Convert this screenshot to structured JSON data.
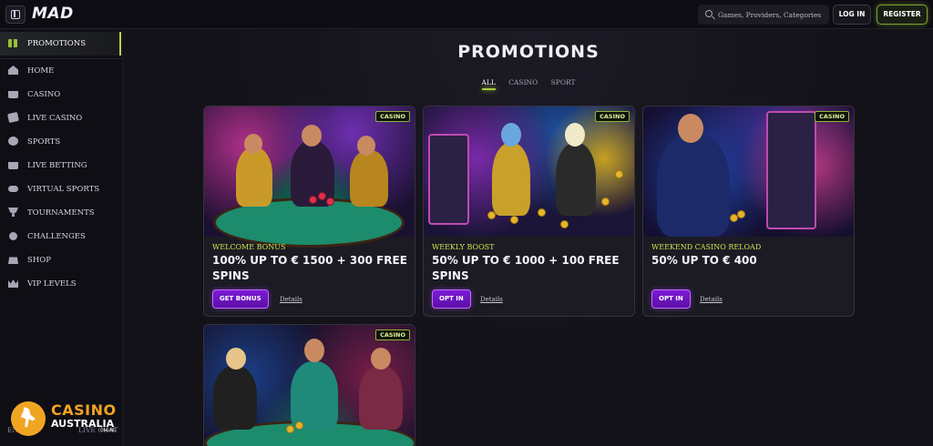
{
  "header": {
    "logo_text": "MAD",
    "search_placeholder": "Games, Providers, Categories",
    "login_label": "LOG IN",
    "register_label": "REGISTER"
  },
  "sidebar": {
    "promotions_label": "PROMOTIONS",
    "items": [
      {
        "label": "HOME",
        "icon": "home-icon"
      },
      {
        "label": "CASINO",
        "icon": "slot-machine-icon"
      },
      {
        "label": "LIVE CASINO",
        "icon": "cards-icon"
      },
      {
        "label": "SPORTS",
        "icon": "football-icon"
      },
      {
        "label": "LIVE BETTING",
        "icon": "tv-icon"
      },
      {
        "label": "VIRTUAL SPORTS",
        "icon": "gamepad-icon"
      },
      {
        "label": "TOURNAMENTS",
        "icon": "trophy-icon"
      },
      {
        "label": "CHALLENGES",
        "icon": "medal-icon"
      },
      {
        "label": "SHOP",
        "icon": "shopping-bag-icon"
      },
      {
        "label": "VIP LEVELS",
        "icon": "crown-icon"
      }
    ],
    "language": "EN",
    "live_chat": "LIVE CHAT"
  },
  "watermark": {
    "line1": "CASINO",
    "line2": "AUSTRALIA",
    "line3": "ONLINE"
  },
  "main": {
    "title": "PROMOTIONS",
    "tabs": [
      {
        "label": "ALL",
        "active": true
      },
      {
        "label": "CASINO",
        "active": false
      },
      {
        "label": "SPORT",
        "active": false
      }
    ],
    "cards": [
      {
        "badge": "CASINO",
        "subtitle": "WELCOME BONUS",
        "title": "100% UP TO € 1500 + 300 FREE SPINS",
        "button": "GET BONUS",
        "link": "Details"
      },
      {
        "badge": "CASINO",
        "subtitle": "WEEKLY BOOST",
        "title": "50% UP TO € 1000 + 100 FREE SPINS",
        "button": "OPT IN",
        "link": "Details"
      },
      {
        "badge": "CASINO",
        "subtitle": "WEEKEND CASINO RELOAD",
        "title": "50% UP TO € 400",
        "button": "OPT IN",
        "link": "Details"
      },
      {
        "badge": "CASINO"
      }
    ]
  },
  "colors": {
    "accent_green": "#a7cc3c",
    "button_purple": "#7c1bd6",
    "background": "#121118"
  }
}
